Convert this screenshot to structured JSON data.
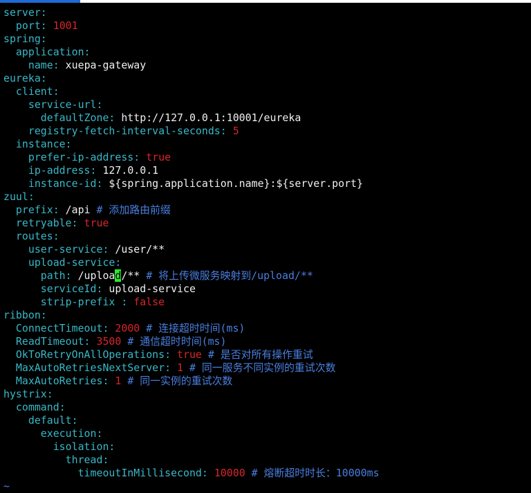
{
  "window": {
    "accent": "#1f6bd6"
  },
  "colors": {
    "key": "#39b8c8",
    "number": "#d9252b",
    "comment": "#4a7fe0",
    "text": "#f0f0f0",
    "cursor": "#2ce82c"
  },
  "lines": [
    [
      {
        "t": "server",
        "c": "k"
      },
      {
        "t": ":",
        "c": "c"
      }
    ],
    [
      {
        "t": "  port",
        "c": "k"
      },
      {
        "t": ": ",
        "c": "c"
      },
      {
        "t": "1001",
        "c": "n"
      }
    ],
    [
      {
        "t": "spring",
        "c": "k"
      },
      {
        "t": ":",
        "c": "c"
      }
    ],
    [
      {
        "t": "  application",
        "c": "k"
      },
      {
        "t": ":",
        "c": "c"
      }
    ],
    [
      {
        "t": "    name",
        "c": "k"
      },
      {
        "t": ": ",
        "c": "c"
      },
      {
        "t": "xuepa-gateway",
        "c": "v"
      }
    ],
    [
      {
        "t": "eureka",
        "c": "k"
      },
      {
        "t": ":",
        "c": "c"
      }
    ],
    [
      {
        "t": "  client",
        "c": "k"
      },
      {
        "t": ":",
        "c": "c"
      }
    ],
    [
      {
        "t": "    service-url",
        "c": "k"
      },
      {
        "t": ":",
        "c": "c"
      }
    ],
    [
      {
        "t": "      defaultZone",
        "c": "k"
      },
      {
        "t": ": ",
        "c": "c"
      },
      {
        "t": "http://127.0.0.1:10001/eureka",
        "c": "v"
      }
    ],
    [
      {
        "t": "    registry-fetch-interval-seconds",
        "c": "k"
      },
      {
        "t": ": ",
        "c": "c"
      },
      {
        "t": "5",
        "c": "n"
      }
    ],
    [
      {
        "t": "  instance",
        "c": "k"
      },
      {
        "t": ":",
        "c": "c"
      }
    ],
    [
      {
        "t": "    prefer-ip-address",
        "c": "k"
      },
      {
        "t": ": ",
        "c": "c"
      },
      {
        "t": "true",
        "c": "n"
      }
    ],
    [
      {
        "t": "    ip-address",
        "c": "k"
      },
      {
        "t": ": ",
        "c": "c"
      },
      {
        "t": "127.0.0.1",
        "c": "v"
      }
    ],
    [
      {
        "t": "    instance-id",
        "c": "k"
      },
      {
        "t": ": ",
        "c": "c"
      },
      {
        "t": "${spring.application.name}:${server.port}",
        "c": "v"
      }
    ],
    [
      {
        "t": "zuul",
        "c": "k"
      },
      {
        "t": ":",
        "c": "c"
      }
    ],
    [
      {
        "t": "  prefix",
        "c": "k"
      },
      {
        "t": ": ",
        "c": "c"
      },
      {
        "t": "/api ",
        "c": "v"
      },
      {
        "t": "# 添加路由前缀",
        "c": "cm"
      }
    ],
    [
      {
        "t": "  retryable",
        "c": "k"
      },
      {
        "t": ": ",
        "c": "c"
      },
      {
        "t": "true",
        "c": "n"
      }
    ],
    [
      {
        "t": "  routes",
        "c": "k"
      },
      {
        "t": ":",
        "c": "c"
      }
    ],
    [
      {
        "t": "    user-service",
        "c": "k"
      },
      {
        "t": ": ",
        "c": "c"
      },
      {
        "t": "/user/**",
        "c": "v"
      }
    ],
    [
      {
        "t": "    upload-service",
        "c": "k"
      },
      {
        "t": ":",
        "c": "c"
      }
    ],
    [
      {
        "t": "      path",
        "c": "k"
      },
      {
        "t": ": ",
        "c": "c"
      },
      {
        "t": "/uploa",
        "c": "v"
      },
      {
        "t": "d",
        "c": "cursor"
      },
      {
        "t": "/** ",
        "c": "v"
      },
      {
        "t": "# 将上传微服务映射到/upload/**",
        "c": "cm"
      }
    ],
    [
      {
        "t": "      serviceId",
        "c": "k"
      },
      {
        "t": ": ",
        "c": "c"
      },
      {
        "t": "upload-service",
        "c": "v"
      }
    ],
    [
      {
        "t": "      strip-prefix ",
        "c": "k"
      },
      {
        "t": ": ",
        "c": "c"
      },
      {
        "t": "false",
        "c": "n"
      }
    ],
    [
      {
        "t": "ribbon",
        "c": "k"
      },
      {
        "t": ":",
        "c": "c"
      }
    ],
    [
      {
        "t": "  ConnectTimeout",
        "c": "k"
      },
      {
        "t": ": ",
        "c": "c"
      },
      {
        "t": "2000",
        "c": "n"
      },
      {
        "t": " ",
        "c": "v"
      },
      {
        "t": "# 连接超时时间(ms)",
        "c": "cm"
      }
    ],
    [
      {
        "t": "  ReadTimeout",
        "c": "k"
      },
      {
        "t": ": ",
        "c": "c"
      },
      {
        "t": "3500",
        "c": "n"
      },
      {
        "t": " ",
        "c": "v"
      },
      {
        "t": "# 通信超时时间(ms)",
        "c": "cm"
      }
    ],
    [
      {
        "t": "  OkToRetryOnAllOperations",
        "c": "k"
      },
      {
        "t": ": ",
        "c": "c"
      },
      {
        "t": "true",
        "c": "n"
      },
      {
        "t": " ",
        "c": "v"
      },
      {
        "t": "# 是否对所有操作重试",
        "c": "cm"
      }
    ],
    [
      {
        "t": "  MaxAutoRetriesNextServer",
        "c": "k"
      },
      {
        "t": ": ",
        "c": "c"
      },
      {
        "t": "1",
        "c": "n"
      },
      {
        "t": " ",
        "c": "v"
      },
      {
        "t": "# 同一服务不同实例的重试次数",
        "c": "cm"
      }
    ],
    [
      {
        "t": "  MaxAutoRetries",
        "c": "k"
      },
      {
        "t": ": ",
        "c": "c"
      },
      {
        "t": "1",
        "c": "n"
      },
      {
        "t": " ",
        "c": "v"
      },
      {
        "t": "# 同一实例的重试次数",
        "c": "cm"
      }
    ],
    [
      {
        "t": "hystrix",
        "c": "k"
      },
      {
        "t": ":",
        "c": "c"
      }
    ],
    [
      {
        "t": "  command",
        "c": "k"
      },
      {
        "t": ":",
        "c": "c"
      }
    ],
    [
      {
        "t": "    default",
        "c": "k"
      },
      {
        "t": ":",
        "c": "c"
      }
    ],
    [
      {
        "t": "      execution",
        "c": "k"
      },
      {
        "t": ":",
        "c": "c"
      }
    ],
    [
      {
        "t": "        isolation",
        "c": "k"
      },
      {
        "t": ":",
        "c": "c"
      }
    ],
    [
      {
        "t": "          thread",
        "c": "k"
      },
      {
        "t": ":",
        "c": "c"
      }
    ],
    [
      {
        "t": "            timeoutInMillisecond",
        "c": "k"
      },
      {
        "t": ": ",
        "c": "c"
      },
      {
        "t": "10000",
        "c": "n"
      },
      {
        "t": " ",
        "c": "v"
      },
      {
        "t": "# 熔断超时时长：10000ms",
        "c": "cm"
      }
    ],
    [
      {
        "t": "~",
        "c": "tilde"
      }
    ]
  ]
}
